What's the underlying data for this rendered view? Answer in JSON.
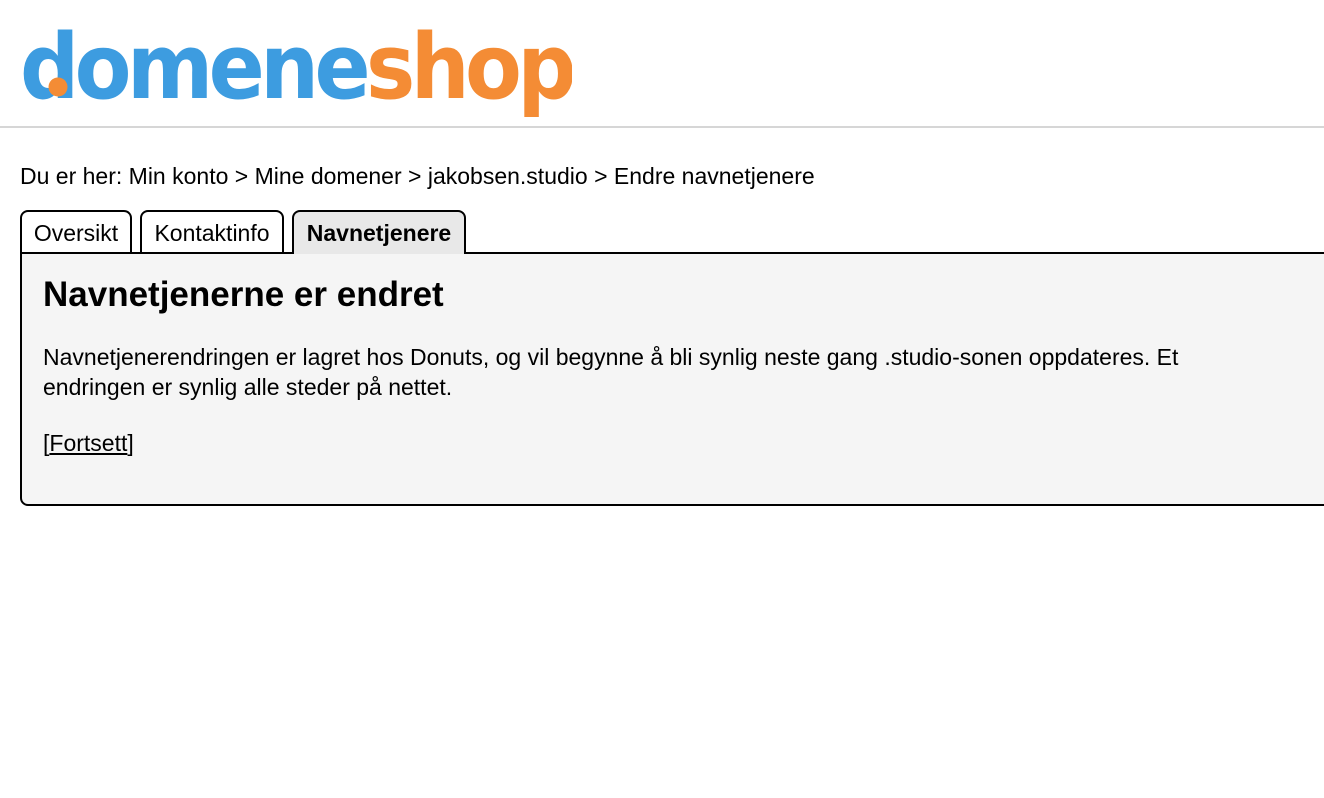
{
  "logo": {
    "part1": "domene",
    "part2": "shop",
    "color_blue": "#3d9ce0",
    "color_orange": "#f48c35"
  },
  "breadcrumb": {
    "prefix": "Du er her:",
    "items": [
      "Min konto",
      "Mine domener",
      "jakobsen.studio",
      "Endre navnetjenere"
    ],
    "separator": ">"
  },
  "tabs": [
    {
      "label": "Oversikt",
      "active": false
    },
    {
      "label": "Kontaktinfo",
      "active": false
    },
    {
      "label": "Navnetjenere",
      "active": true
    }
  ],
  "panel": {
    "heading": "Navnetjenerne er endret",
    "message_line1": "Navnetjenerendringen er lagret hos Donuts, og vil begynne å bli synlig neste gang .studio-sonen oppdateres. Et",
    "message_line2": "endringen er synlig alle steder på nettet.",
    "continue_open": "[",
    "continue_label": "Fortsett",
    "continue_close": "]"
  }
}
